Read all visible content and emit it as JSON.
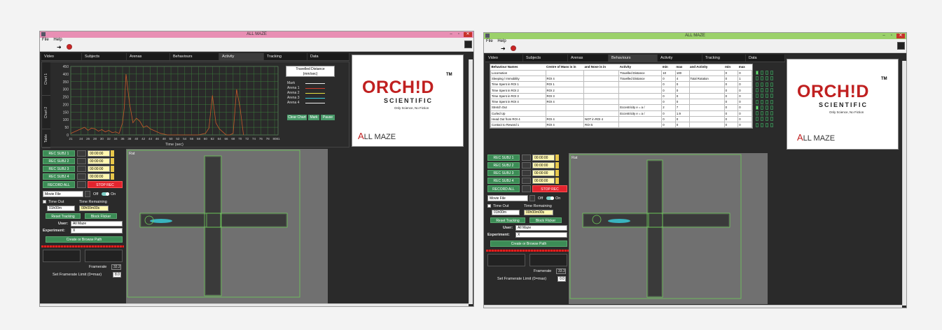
{
  "windows": [
    {
      "title": "ALL MAZE",
      "menu": [
        "File",
        "Help"
      ],
      "tabs": [
        "Video",
        "Subjects",
        "Arenas",
        "Behaviours",
        "Activity",
        "Tracking",
        "Data"
      ],
      "active_tab": "Activity",
      "side_tabs": [
        "Chart 1",
        "Chart 2",
        "Table"
      ],
      "measure": {
        "line1": "Travelled Distance",
        "line2": "(mm/sec)"
      },
      "legend": [
        "Mark",
        "Arena 1",
        "Arena 2",
        "Arena 3",
        "Arena 4"
      ],
      "chart_buttons": [
        "Clear Chart",
        "Mark",
        "Pause"
      ]
    },
    {
      "title": "ALL MAZE",
      "menu": [
        "File",
        "Help"
      ],
      "tabs": [
        "Video",
        "Subjects",
        "Arenas",
        "Behaviours",
        "Activity",
        "Tracking",
        "Data"
      ],
      "active_tab": "Behaviours"
    }
  ],
  "chart_data": {
    "type": "line",
    "title": "",
    "xlabel": "Time (sec)",
    "ylabel": "",
    "ylim": [
      0,
      450
    ],
    "xlim": [
      21,
      81
    ],
    "y_ticks": [
      "450",
      "400",
      "350",
      "300",
      "250",
      "200",
      "150",
      "100",
      "50",
      "0"
    ],
    "x_ticks": [
      "21",
      "24",
      "26",
      "28",
      "30",
      "32",
      "34",
      "36",
      "38",
      "40",
      "42",
      "44",
      "46",
      "48",
      "50",
      "52",
      "54",
      "56",
      "58",
      "60",
      "62",
      "64",
      "66",
      "68",
      "70",
      "72",
      "74",
      "76",
      "78",
      "80",
      "81"
    ],
    "series": [
      {
        "name": "Arena 1",
        "color": "#c85a2a",
        "x": [
          21,
          22,
          24,
          25,
          26,
          27,
          28,
          29,
          30,
          31,
          32,
          33,
          34,
          35,
          36,
          36.5,
          37,
          38,
          39,
          40,
          41,
          42,
          43,
          44,
          45,
          46,
          47,
          48,
          49,
          50,
          52,
          54,
          56,
          57,
          58,
          59,
          60,
          61,
          62,
          63,
          64,
          65,
          66,
          67,
          68,
          69,
          70,
          71
        ],
        "values": [
          10,
          20,
          40,
          50,
          30,
          45,
          40,
          25,
          35,
          20,
          30,
          15,
          20,
          10,
          80,
          180,
          400,
          210,
          80,
          110,
          90,
          50,
          60,
          40,
          30,
          20,
          10,
          5,
          0,
          0,
          0,
          0,
          0,
          0,
          0,
          5,
          10,
          45,
          260,
          80,
          40,
          20,
          0,
          0,
          10,
          300,
          180,
          0
        ]
      }
    ]
  },
  "logo": {
    "tm": "TM",
    "brand": "ORCH!D",
    "sub": "SCIENTIFIC",
    "tagline": "Only Science, No Fiction",
    "product_a": "A",
    "product_rest": "LL MAZE"
  },
  "controls1": {
    "rec_subj": [
      "REC SUBJ 1",
      "REC SUBJ 2",
      "REC SUBJ 3",
      "REC SUBJ 4"
    ],
    "rec_times": [
      "00:00:00",
      "00:00:00",
      "00:00:00",
      "00:00:00"
    ],
    "record_all": "RECORD ALL",
    "stop_rec": "STOP REC",
    "source": "Movie File",
    "off": "Off",
    "on": "On",
    "time_out": "Time Out",
    "time_remaining": "Time Remaining",
    "time_out_value": "01h00m",
    "time_remaining_value": "00h00m00s",
    "reset_tracking": "Reset Tracking",
    "block_flicker": "Block Flicker",
    "user_label": "User:",
    "user_value": "All Maze",
    "experiment_label": "Experiment:",
    "experiment_value": "X",
    "create_path": "Create or Browse Path",
    "framerate_label": "Framerate",
    "framerate_value": "32.2",
    "limit_label": "Set Framerate Limit (0=max)",
    "limit_value": "8.0",
    "video_label": "Rat"
  },
  "controls2": {
    "rec_subj": [
      "REC SUBJ 1",
      "REC SUBJ 2",
      "REC SUBJ 3",
      "REC SUBJ 4"
    ],
    "rec_times": [
      "00:00:00",
      "00:00:00",
      "00:00:00",
      "00:00:00"
    ],
    "record_all": "RECORD ALL",
    "stop_rec": "STOP REC",
    "source": "Movie File",
    "off": "Off",
    "on": "On",
    "time_out": "Time Out",
    "time_remaining": "Time Remaining",
    "time_out_value": "01h00m",
    "time_remaining_value": "00h00m00s",
    "reset_tracking": "Reset Tracking",
    "block_flicker": "Block Flicker",
    "user_label": "User:",
    "user_value": "All Maze",
    "experiment_label": "Experiment:",
    "experiment_value": "X",
    "create_path": "Create or Browse Path",
    "framerate_label": "Framerate",
    "framerate_value": "33.3",
    "limit_label": "Set Framerate Limit (0=max)",
    "limit_value": "0.0",
    "video_label": "Rat"
  },
  "behaviours": {
    "headers": [
      "Behaviour Names",
      "Centre of Mass is in",
      "and Nose is in",
      "Activity",
      "min",
      "max",
      "and Activity",
      "min",
      "max"
    ],
    "rows": [
      [
        "Locomotion",
        "",
        "",
        "Travelled Distance",
        "10",
        "100",
        "",
        "0",
        "0"
      ],
      [
        "Sleeping / Immobility",
        "ROI 4",
        "",
        "Travelled Distance",
        "0",
        "4",
        "Total Rotation",
        "0",
        "1"
      ],
      [
        "Time Spent in ROI 1",
        "ROI 1",
        "",
        "",
        "0",
        "0",
        "",
        "0",
        "0"
      ],
      [
        "Time Spent in ROI 2",
        "ROI 2",
        "",
        "",
        "0",
        "0",
        "",
        "0",
        "0"
      ],
      [
        "Time Spent in ROI 3",
        "ROI 3",
        "",
        "",
        "0",
        "0",
        "",
        "0",
        "0"
      ],
      [
        "Time Spent in ROI 4",
        "ROI 4",
        "",
        "",
        "0",
        "0",
        "",
        "0",
        "0"
      ],
      [
        "Stretch Out",
        "",
        "",
        "Eccentricity e = a /",
        "2",
        "7",
        "",
        "0",
        "0"
      ],
      [
        "Curled Up",
        "",
        "",
        "Eccentricity e = a /",
        "0",
        "1.9",
        "",
        "0",
        "0"
      ],
      [
        "Head Out from ROI 4",
        "ROI 4",
        "NOT in ROI 4",
        "",
        "0",
        "0",
        "",
        "0",
        "0"
      ],
      [
        "Contact to Reward 1",
        "ROI 4",
        "ROI 5",
        "",
        "0",
        "0",
        "",
        "0",
        "0"
      ]
    ]
  },
  "colors": {
    "pink_title": "#e88fb4",
    "green_title": "#9bd16a",
    "accent_green": "#3c8c56",
    "stop_red": "#e2242e"
  }
}
